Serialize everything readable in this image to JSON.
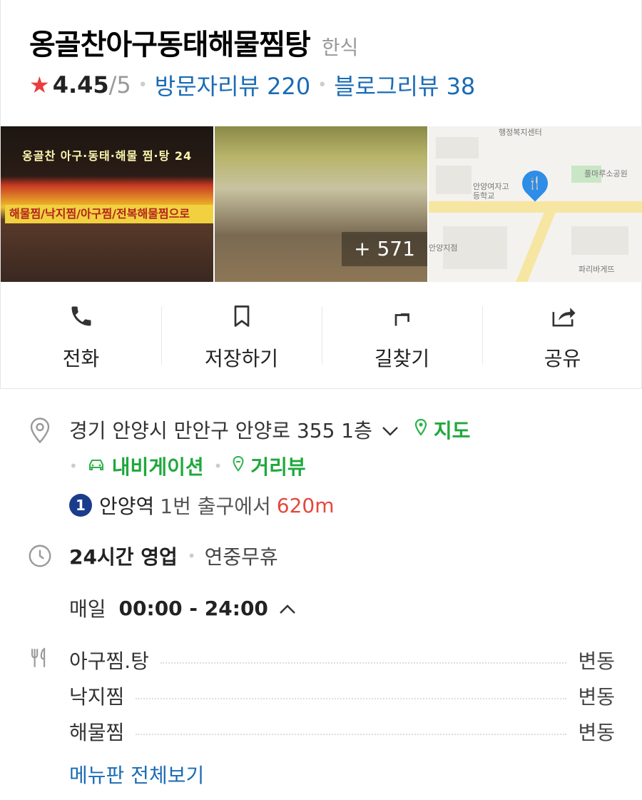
{
  "place": {
    "name": "옹골찬아구동태해물찜탕",
    "category": "한식"
  },
  "rating": {
    "star_icon": "star-icon",
    "score": "4.45",
    "max": "/5",
    "visitor_reviews": "방문자리뷰 220",
    "blog_reviews": "블로그리뷰 38",
    "separator": "•"
  },
  "photos": {
    "sign_top": "옹골찬 아구·동태·해물 찜·탕 24",
    "sign_banner": "해물찜/낙지찜/아구찜/전복해물찜으로",
    "more_count": "+ 571"
  },
  "map_thumb": {
    "labels": [
      "행정복지센터",
      "안양여자고등학교",
      "풀마루소공원",
      "안양지점",
      "파리바게뜨"
    ]
  },
  "actions": [
    {
      "label": "전화",
      "icon": "phone-icon"
    },
    {
      "label": "저장하기",
      "icon": "bookmark-icon"
    },
    {
      "label": "길찾기",
      "icon": "directions-icon"
    },
    {
      "label": "공유",
      "icon": "share-icon"
    }
  ],
  "address": {
    "text": "경기 안양시 만안구 안양로 355 1층",
    "map_link": "지도",
    "navigation_link": "내비게이션",
    "streetview_link": "거리뷰"
  },
  "subway": {
    "line": "1",
    "line_color": "#1b3c8c",
    "station": "안양역",
    "exit": "1번 출구에서",
    "distance": "620m"
  },
  "hours": {
    "status": "24시간 영업",
    "note": "연중무휴",
    "day": "매일",
    "time": "00:00 - 24:00"
  },
  "menu": {
    "items": [
      {
        "name": "아구찜.탕",
        "price": "변동"
      },
      {
        "name": "낙지찜",
        "price": "변동"
      },
      {
        "name": "해물찜",
        "price": "변동"
      }
    ],
    "view_all": "메뉴판 전체보기"
  },
  "colors": {
    "accent_blue": "#1a6bb5",
    "accent_green": "#2db34a",
    "distance_red": "#e5473c",
    "star_red": "#ea3e3e"
  }
}
